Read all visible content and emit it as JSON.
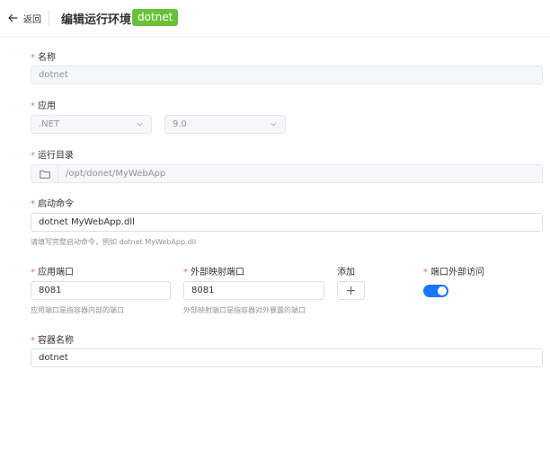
{
  "header": {
    "back_label": "返回",
    "title": "编辑运行环境 -",
    "tag": "dotnet"
  },
  "form": {
    "name": {
      "label": "名称",
      "value": "dotnet"
    },
    "app": {
      "label": "应用",
      "type_value": ".NET",
      "version_value": "9.0"
    },
    "run_dir": {
      "label": "运行目录",
      "value": "/opt/donet/MyWebApp"
    },
    "start_cmd": {
      "label": "启动命令",
      "value": "dotnet MyWebApp.dll",
      "hint": "请填写完整启动命令，例如 dotnet MyWebApp.dll"
    },
    "app_port": {
      "label": "应用端口",
      "value": "8081",
      "hint": "应用端口是指容器内部的端口"
    },
    "ext_port": {
      "label": "外部映射端口",
      "value": "8081",
      "hint": "外部映射端口是指容器对外暴露的端口"
    },
    "add": {
      "label": "添加",
      "button_glyph": "+"
    },
    "port_access": {
      "label": "端口外部访问",
      "enabled": true
    },
    "container_name": {
      "label": "容器名称",
      "value": "dotnet"
    }
  },
  "colors": {
    "accent": "#1677ff",
    "tag": "#67c23a",
    "required": "#f56c6c"
  }
}
